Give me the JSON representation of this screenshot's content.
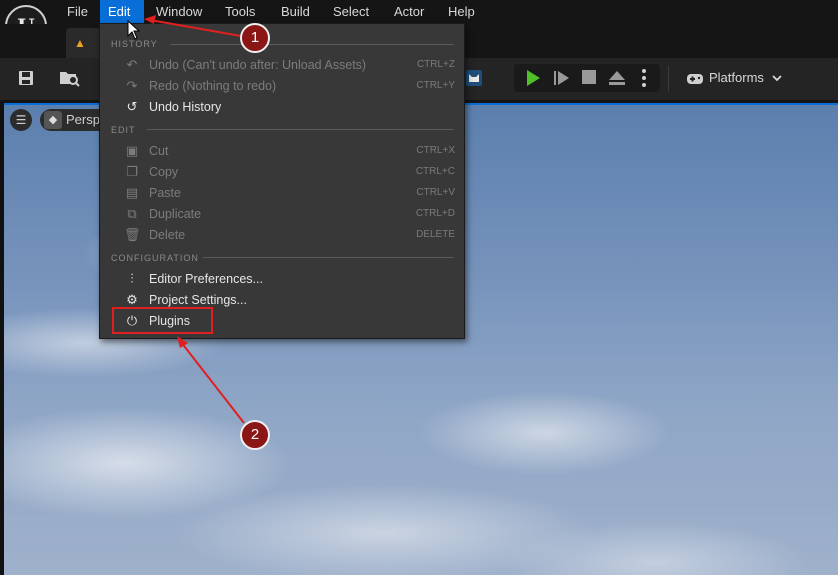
{
  "app": {
    "logo_text": "U",
    "menu": [
      "File",
      "Edit",
      "Window",
      "Tools",
      "Build",
      "Select",
      "Actor",
      "Help"
    ],
    "active_menu": "Edit"
  },
  "toolbar": {
    "platforms_label": "Platforms",
    "icons": [
      "save-icon",
      "content-browser-icon",
      "cat-icon",
      "play-icon",
      "step-icon",
      "stop-icon",
      "eject-icon",
      "more-icon",
      "gamepad-icon"
    ]
  },
  "viewport": {
    "view_mode_label": "Perspective"
  },
  "edit_menu": {
    "sections": {
      "history": "HISTORY",
      "edit": "EDIT",
      "configuration": "CONFIGURATION"
    },
    "items": {
      "undo": {
        "label": "Undo (Can't undo after: Unload Assets)",
        "shortcut": "CTRL+Z",
        "enabled": false
      },
      "redo": {
        "label": "Redo (Nothing to redo)",
        "shortcut": "CTRL+Y",
        "enabled": false
      },
      "undo_history": {
        "label": "Undo History",
        "enabled": true
      },
      "cut": {
        "label": "Cut",
        "shortcut": "CTRL+X",
        "enabled": false
      },
      "copy": {
        "label": "Copy",
        "shortcut": "CTRL+C",
        "enabled": false
      },
      "paste": {
        "label": "Paste",
        "shortcut": "CTRL+V",
        "enabled": false
      },
      "duplicate": {
        "label": "Duplicate",
        "shortcut": "CTRL+D",
        "enabled": false
      },
      "delete": {
        "label": "Delete",
        "shortcut": "DELETE",
        "enabled": false
      },
      "editor_preferences": {
        "label": "Editor Preferences...",
        "enabled": true
      },
      "project_settings": {
        "label": "Project Settings...",
        "enabled": true
      },
      "plugins": {
        "label": "Plugins",
        "enabled": true
      }
    }
  },
  "annotations": {
    "badge_1": "1",
    "badge_2": "2"
  },
  "colors": {
    "accent": "#0a6ed8",
    "annotation_red": "#e02020",
    "badge_fill": "#8a1616"
  }
}
